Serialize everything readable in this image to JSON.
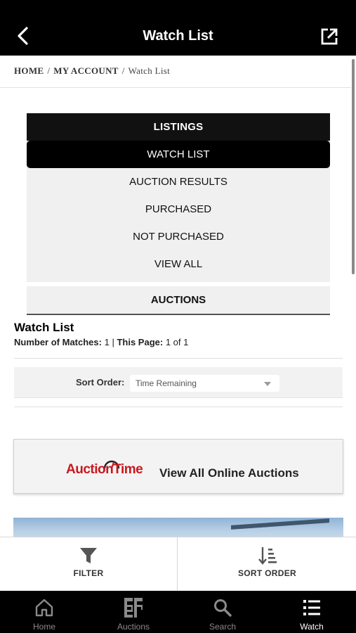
{
  "header": {
    "title": "Watch List"
  },
  "breadcrumb": {
    "home": "HOME",
    "account": "MY ACCOUNT",
    "current": "Watch List",
    "separator": "/"
  },
  "menu": {
    "header": "LISTINGS",
    "items": [
      {
        "label": "WATCH LIST",
        "active": true
      },
      {
        "label": "AUCTION RESULTS",
        "active": false
      },
      {
        "label": "PURCHASED",
        "active": false
      },
      {
        "label": "NOT PURCHASED",
        "active": false
      },
      {
        "label": "VIEW ALL",
        "active": false
      }
    ],
    "auctions_label": "AUCTIONS"
  },
  "watchlist": {
    "title": "Watch List",
    "matches_label": "Number of Matches:",
    "matches_value": "1",
    "separator": "|",
    "page_label": "This Page:",
    "page_value": "1 of 1"
  },
  "sort": {
    "label": "Sort Order:",
    "value": "Time Remaining"
  },
  "banner": {
    "logo_text": "AuctionTime",
    "cta": "View All Online Auctions",
    "logo_color": "#c8181e"
  },
  "actions": {
    "filter": "FILTER",
    "sort_order": "SORT ORDER"
  },
  "tabs": [
    {
      "label": "Home",
      "icon": "home-icon",
      "active": false
    },
    {
      "label": "Auctions",
      "icon": "auctions-logo-icon",
      "active": false
    },
    {
      "label": "Search",
      "icon": "search-icon",
      "active": false
    },
    {
      "label": "Watch",
      "icon": "list-icon",
      "active": true
    }
  ],
  "colors": {
    "bar": "#000000",
    "accent_red": "#c8181e",
    "menu_bg": "#f0f0f0"
  }
}
